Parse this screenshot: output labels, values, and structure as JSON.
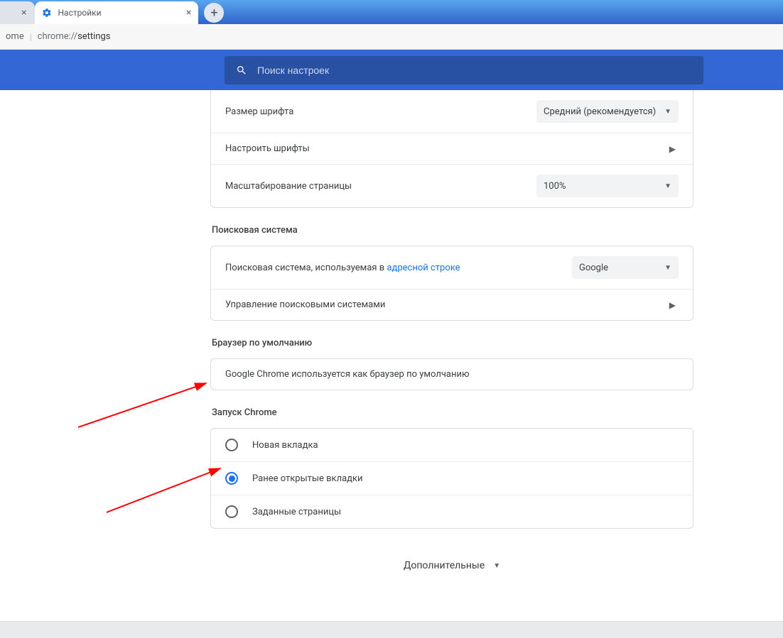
{
  "tabs": {
    "active_title": "Настройки"
  },
  "address_bar": {
    "home_label": "ome",
    "url_prefix": "chrome://",
    "url_path": "settings"
  },
  "search": {
    "placeholder": "Поиск настроек"
  },
  "appearance": {
    "font_size_label": "Размер шрифта",
    "font_size_value": "Средний (рекомендуется)",
    "customize_fonts_label": "Настроить шрифты",
    "page_zoom_label": "Масштабирование страницы",
    "page_zoom_value": "100%"
  },
  "search_engine": {
    "section_title": "Поисковая система",
    "row1_prefix": "Поисковая система, используемая в ",
    "row1_link": "адресной строке",
    "row1_value": "Google",
    "row2_label": "Управление поисковыми системами"
  },
  "default_browser": {
    "section_title": "Браузер по умолчанию",
    "row_text": "Google Chrome используется как браузер по умолчанию"
  },
  "startup": {
    "section_title": "Запуск Chrome",
    "options": [
      "Новая вкладка",
      "Ранее открытые вкладки",
      "Заданные страницы"
    ],
    "selected_index": 1
  },
  "advanced_label": "Дополнительные"
}
